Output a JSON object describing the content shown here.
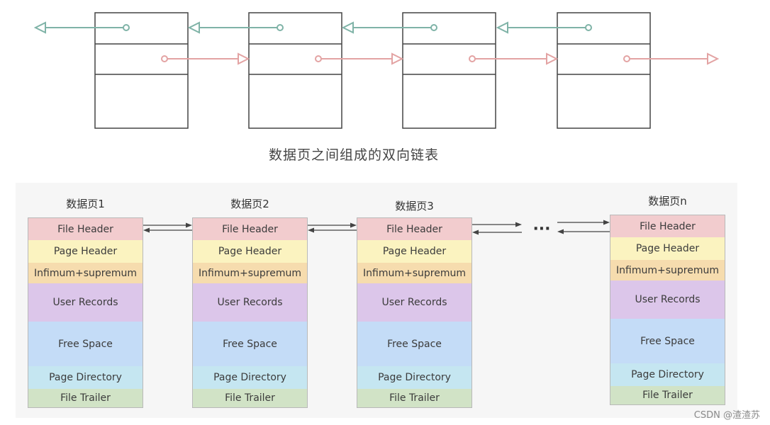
{
  "top_diagram": {
    "caption": "数据页之间组成的双向链表",
    "node_count": 4,
    "colors": {
      "box_stroke": "#444444",
      "prev_link": "#7fb3a7",
      "next_link": "#e3a3a3"
    }
  },
  "bottom_diagram": {
    "ellipsis": "···",
    "pages": [
      {
        "title": "数据页1"
      },
      {
        "title": "数据页2"
      },
      {
        "title": "数据页3"
      },
      {
        "title": "数据页n"
      }
    ],
    "segments": [
      {
        "label": "File Header",
        "color": "#f2ccce"
      },
      {
        "label": "Page Header",
        "color": "#fbf3c0"
      },
      {
        "label": "Infimum+supremum",
        "color": "#f6dcae"
      },
      {
        "label": "User Records",
        "color": "#dcc6ea"
      },
      {
        "label": "Free Space",
        "color": "#c4dcf7"
      },
      {
        "label": "Page Directory",
        "color": "#c5e6f1"
      },
      {
        "label": "File Trailer",
        "color": "#d1e3c6"
      }
    ]
  },
  "watermark": "CSDN @渣渣苏"
}
